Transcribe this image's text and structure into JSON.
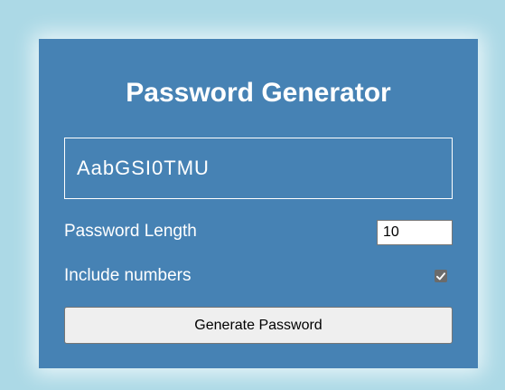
{
  "app": {
    "title": "Password Generator"
  },
  "password": {
    "value": "AabGSI0TMU"
  },
  "options": {
    "length_label": "Password Length",
    "length_value": "10",
    "numbers_label": "Include numbers",
    "numbers_checked": true
  },
  "actions": {
    "generate_label": "Generate Password"
  },
  "colors": {
    "background": "#acd9e6",
    "card": "#4682b4",
    "text": "#ffffff",
    "button": "#efefef"
  },
  "icons": {
    "checkbox_mark": "check-icon"
  }
}
